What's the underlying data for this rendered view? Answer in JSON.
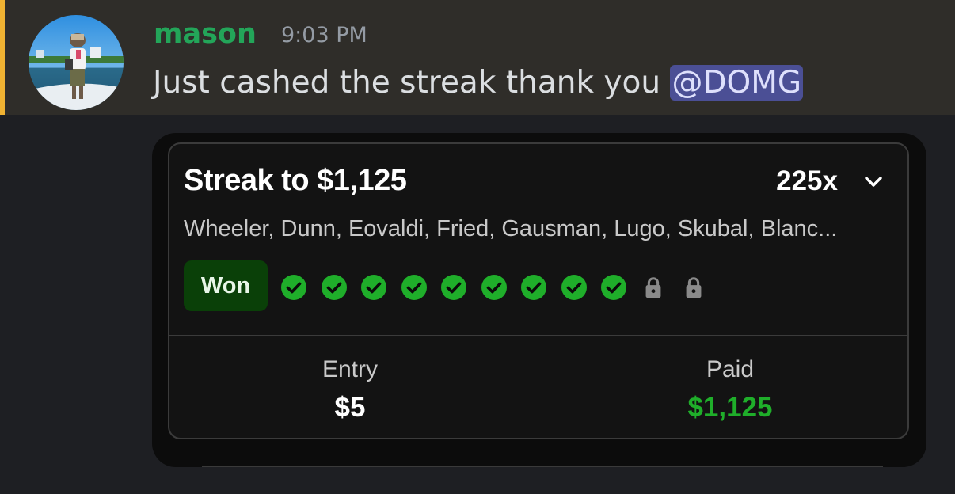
{
  "message": {
    "username": "mason",
    "timestamp": "9:03 PM",
    "text": "Just cashed the streak thank you ",
    "mention": "@DOMG",
    "avatar": "user-avatar-photo"
  },
  "card": {
    "title": "Streak to $1,125",
    "multiplier": "225x",
    "players": "Wheeler, Dunn, Eovaldi, Fried, Gausman, Lugo, Skubal, Blanc...",
    "status_badge": "Won",
    "legs": [
      {
        "state": "won",
        "icon": "check-circle-icon"
      },
      {
        "state": "won",
        "icon": "check-circle-icon"
      },
      {
        "state": "won",
        "icon": "check-circle-icon"
      },
      {
        "state": "won",
        "icon": "check-circle-icon"
      },
      {
        "state": "won",
        "icon": "check-circle-icon"
      },
      {
        "state": "won",
        "icon": "check-circle-icon"
      },
      {
        "state": "won",
        "icon": "check-circle-icon"
      },
      {
        "state": "won",
        "icon": "check-circle-icon"
      },
      {
        "state": "won",
        "icon": "check-circle-icon"
      },
      {
        "state": "locked",
        "icon": "lock-icon"
      },
      {
        "state": "locked",
        "icon": "lock-icon"
      }
    ],
    "entry_label": "Entry",
    "entry_value": "$5",
    "paid_label": "Paid",
    "paid_value": "$1,125"
  },
  "colors": {
    "username": "#23a559",
    "mention_bg": "#4b4f95",
    "mention_bar": "#f0b232",
    "won_check": "#1fae2a",
    "won_badge_bg": "#0a4008",
    "paid_value": "#1fae2a",
    "lock": "#8a8a8a"
  }
}
